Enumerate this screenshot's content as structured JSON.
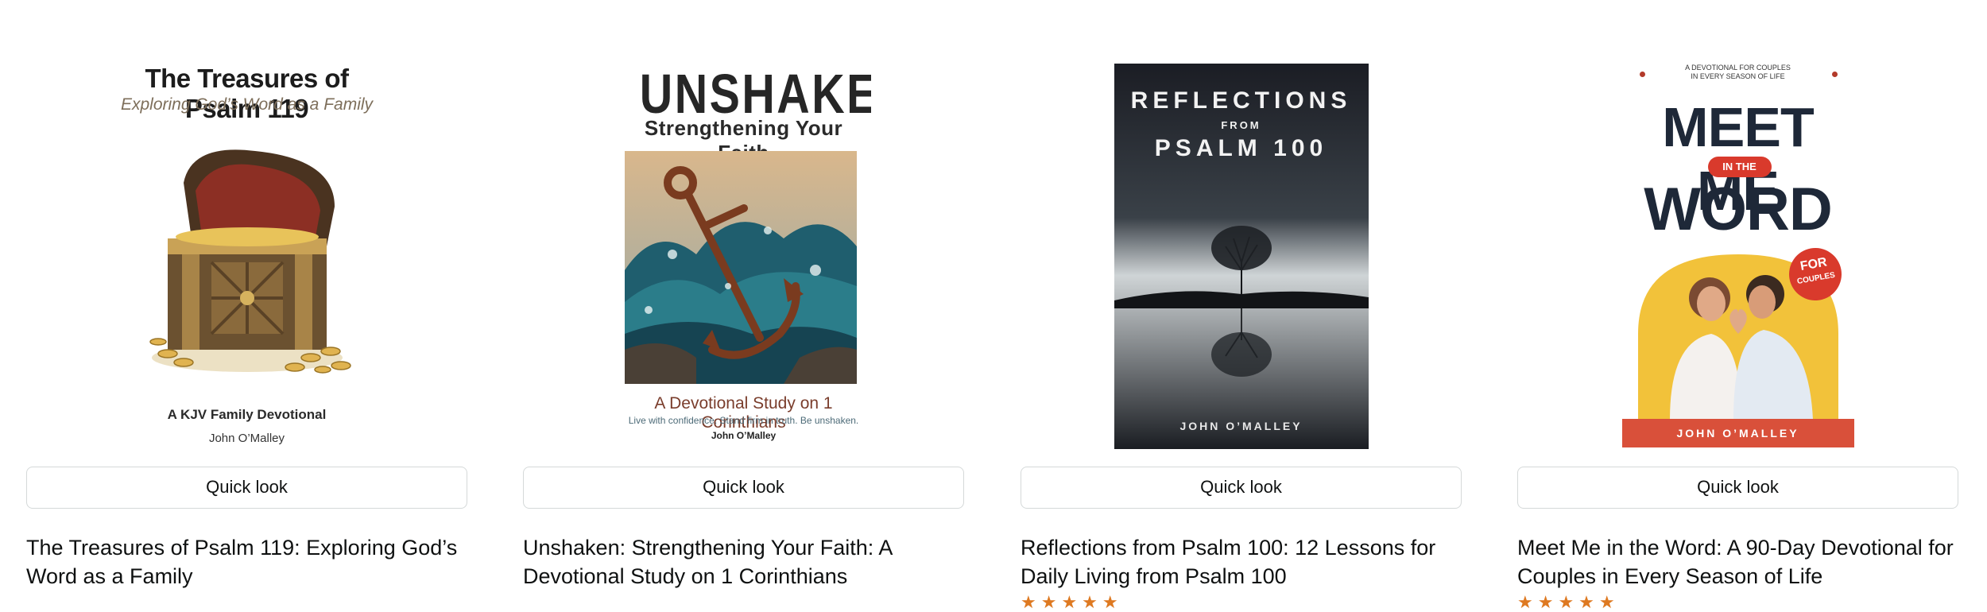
{
  "products": [
    {
      "title": "The Treasures of Psalm 119: Exploring God’s Word as a Family",
      "quick_look": "Quick look",
      "cover": {
        "title": "The Treasures of Psalm 119",
        "subtitle": "Exploring God’s Word as a Family",
        "tagline": "A KJV Family Devotional",
        "author": "John O’Malley"
      }
    },
    {
      "title": "Unshaken: Strengthening Your Faith: A Devotional Study on 1 Corinthians",
      "quick_look": "Quick look",
      "cover": {
        "title": "UNSHAKEN",
        "subtitle": "Strengthening Your Faith",
        "tagline": "A Devotional Study on 1 Corinthians",
        "blurb": "Live with confidence. Stand firm in truth. Be unshaken.",
        "author": "John O’Malley"
      }
    },
    {
      "title": "Reflections from Psalm 100: 12 Lessons for Daily Living from Psalm 100",
      "quick_look": "Quick look",
      "cover": {
        "line1": "REFLECTIONS",
        "line2": "FROM",
        "line3": "PSALM 100",
        "author": "JOHN O’MALLEY"
      }
    },
    {
      "title": "Meet Me in the Word: A 90-Day Devotional for Couples in Every Season of Life",
      "quick_look": "Quick look",
      "cover": {
        "top_line1": "A DEVOTIONAL FOR COUPLES",
        "top_line2": "IN EVERY SEASON OF LIFE",
        "title1": "MEET ME",
        "pill": "IN THE",
        "title2": "WORD",
        "badge1": "FOR",
        "badge2": "COUPLES",
        "author": "JOHN O’MALLEY"
      }
    }
  ],
  "colors": {
    "star": "#de7921",
    "button_border": "#d5d9d9",
    "text": "#0f1111"
  }
}
